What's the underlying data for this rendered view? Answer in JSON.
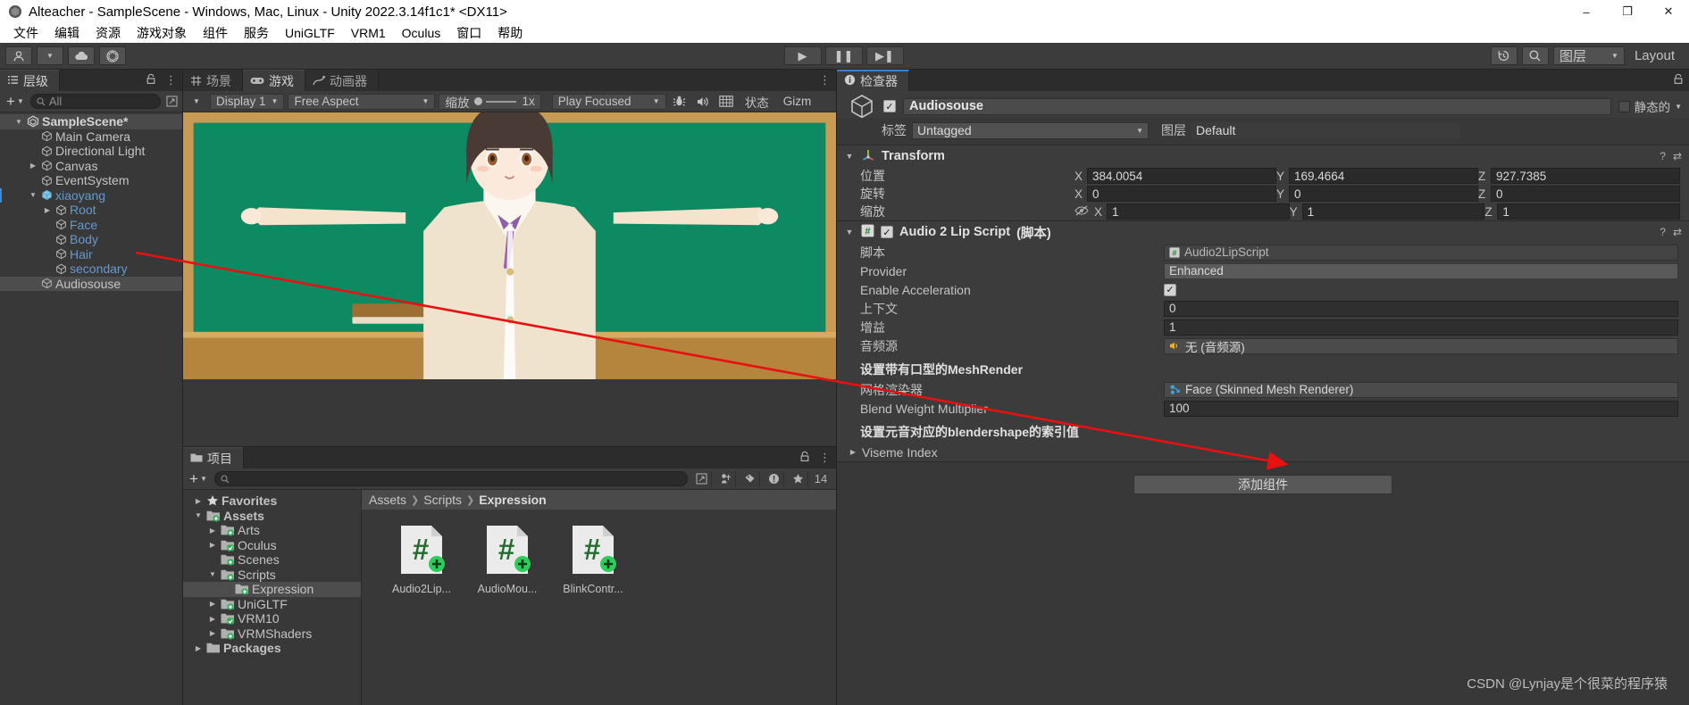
{
  "window": {
    "title": "Alteacher - SampleScene - Windows, Mac, Linux - Unity 2022.3.14f1c1* <DX11>",
    "minimize": "–",
    "maximize": "❐",
    "close": "✕"
  },
  "menu": [
    "文件",
    "编辑",
    "资源",
    "游戏对象",
    "组件",
    "服务",
    "UniGLTF",
    "VRM1",
    "Oculus",
    "窗口",
    "帮助"
  ],
  "toolbar": {
    "account_icon": "account-icon",
    "cloud_icon": "cloud-icon",
    "unity_icon": "unity-icon",
    "play": "▶",
    "pause": "❚❚",
    "step": "▶❚",
    "history_icon": "history-icon",
    "search_icon": "search-icon",
    "layers_label": "图层",
    "layout_label": "Layout"
  },
  "hierarchy": {
    "tab": "层级",
    "lock_icon": "lock-icon",
    "menu_icon": "kebab-icon",
    "add_label": "+",
    "search_placeholder": "All",
    "items": [
      {
        "label": "SampleScene*",
        "depth": 0,
        "tri": "▼",
        "icon": "unity-scene-icon",
        "bold": true,
        "selected_row": true,
        "blue": false
      },
      {
        "label": "Main Camera",
        "depth": 1,
        "tri": "",
        "icon": "cube-icon",
        "bold": false,
        "blue": false
      },
      {
        "label": "Directional Light",
        "depth": 1,
        "tri": "",
        "icon": "cube-icon",
        "bold": false,
        "blue": false
      },
      {
        "label": "Canvas",
        "depth": 1,
        "tri": "▶",
        "icon": "cube-icon",
        "bold": false,
        "blue": false
      },
      {
        "label": "EventSystem",
        "depth": 1,
        "tri": "",
        "icon": "cube-icon",
        "bold": false,
        "blue": false
      },
      {
        "label": "xiaoyang",
        "depth": 1,
        "tri": "▼",
        "icon": "prefab-icon",
        "bold": false,
        "blue": true,
        "marker": true
      },
      {
        "label": "Root",
        "depth": 2,
        "tri": "▶",
        "icon": "cube-icon",
        "bold": false,
        "blue": true
      },
      {
        "label": "Face",
        "depth": 2,
        "tri": "",
        "icon": "cube-icon",
        "bold": false,
        "blue": true
      },
      {
        "label": "Body",
        "depth": 2,
        "tri": "",
        "icon": "cube-icon",
        "bold": false,
        "blue": true
      },
      {
        "label": "Hair",
        "depth": 2,
        "tri": "",
        "icon": "cube-icon",
        "bold": false,
        "blue": true
      },
      {
        "label": "secondary",
        "depth": 2,
        "tri": "",
        "icon": "cube-icon",
        "bold": false,
        "blue": true
      },
      {
        "label": "Audiosouse",
        "depth": 1,
        "tri": "",
        "icon": "cube-icon",
        "bold": false,
        "blue": false,
        "selected": true
      }
    ]
  },
  "centerTabs": [
    {
      "label": "场景",
      "icon": "scene-icon",
      "active": false
    },
    {
      "label": "游戏",
      "icon": "game-icon",
      "active": true
    },
    {
      "label": "动画器",
      "icon": "animator-icon",
      "active": false
    }
  ],
  "gameview": {
    "display": "Display 1",
    "aspect": "Free Aspect",
    "scale_label": "缩放",
    "scale_value": "1x",
    "play_mode": "Play Focused",
    "mute_icon": "mute-audio-icon",
    "bug_icon": "bug-icon",
    "stats_label": "状态",
    "gizmos_label": "Gizm",
    "frame_icon": "frame-icon",
    "menu_icon": "kebab-icon"
  },
  "project": {
    "tab": "项目",
    "lock_icon": "lock-icon",
    "menu_icon": "kebab-icon",
    "add_label": "+",
    "search_placeholder": "",
    "hidden_count": "14",
    "icons": [
      "save-search-icon",
      "new-search-icon",
      "label-icon",
      "warning-icon",
      "favorite-icon",
      "hidden-icon"
    ],
    "tree": [
      {
        "label": "Favorites",
        "depth": 0,
        "tri": "▶",
        "icon": "star-icon",
        "bold": true
      },
      {
        "label": "Assets",
        "depth": 0,
        "tri": "▼",
        "icon": "folder-plus-icon",
        "bold": true
      },
      {
        "label": "Arts",
        "depth": 1,
        "tri": "▶",
        "icon": "folder-plus-icon",
        "bold": false
      },
      {
        "label": "Oculus",
        "depth": 1,
        "tri": "▶",
        "icon": "folder-check-icon",
        "bold": false
      },
      {
        "label": "Scenes",
        "depth": 1,
        "tri": "",
        "icon": "folder-plus-icon",
        "bold": false
      },
      {
        "label": "Scripts",
        "depth": 1,
        "tri": "▼",
        "icon": "folder-plus-icon",
        "bold": false
      },
      {
        "label": "Expression",
        "depth": 2,
        "tri": "",
        "icon": "folder-plus-icon",
        "bold": false,
        "selected": true
      },
      {
        "label": "UniGLTF",
        "depth": 1,
        "tri": "▶",
        "icon": "folder-plus-icon",
        "bold": false
      },
      {
        "label": "VRM10",
        "depth": 1,
        "tri": "▶",
        "icon": "folder-check-icon",
        "bold": false
      },
      {
        "label": "VRMShaders",
        "depth": 1,
        "tri": "▶",
        "icon": "folder-plus-icon",
        "bold": false
      },
      {
        "label": "Packages",
        "depth": 0,
        "tri": "▶",
        "icon": "folder-icon",
        "bold": true
      }
    ],
    "breadcrumb": [
      "Assets",
      "Scripts",
      "Expression"
    ],
    "assets": [
      {
        "name": "Audio2Lip...",
        "type": "csharp-script"
      },
      {
        "name": "AudioMou...",
        "type": "csharp-script"
      },
      {
        "name": "BlinkContr...",
        "type": "csharp-script"
      }
    ]
  },
  "inspector": {
    "tab": "检查器",
    "info_icon": "info-icon",
    "lock_icon": "lock-icon",
    "object": {
      "name": "Audiosouse",
      "enabled": true,
      "static_label": "静态的",
      "tag_label": "标签",
      "tag_value": "Untagged",
      "layer_label": "图层",
      "layer_value": "Default"
    },
    "transform": {
      "title": "Transform",
      "help_icon": "help-icon",
      "menu_icon": "kebab-icon",
      "rows": [
        {
          "label": "位置",
          "x": "384.0054",
          "y": "169.4664",
          "z": "927.7385",
          "lock": false
        },
        {
          "label": "旋转",
          "x": "0",
          "y": "0",
          "z": "0",
          "lock": false
        },
        {
          "label": "缩放",
          "x": "1",
          "y": "1",
          "z": "1",
          "lock": true
        }
      ],
      "axes": [
        "X",
        "Y",
        "Z"
      ]
    },
    "script_component": {
      "title": "Audio 2 Lip Script",
      "suffix": "(脚本)",
      "enabled": true,
      "help_icon": "help-icon",
      "menu_icon": "kebab-icon",
      "rows": [
        {
          "label": "脚本",
          "value": "Audio2LipScript",
          "kind": "object",
          "dim": true,
          "icon": "csharp-icon"
        },
        {
          "label": "Provider",
          "value": "Enhanced",
          "kind": "dropdown"
        },
        {
          "label": "Enable Acceleration",
          "value": "✓",
          "kind": "checkbox"
        },
        {
          "label": "上下文",
          "value": "0",
          "kind": "field"
        },
        {
          "label": "增益",
          "value": "1",
          "kind": "field"
        },
        {
          "label": "音频源",
          "value": "无 (音频源)",
          "kind": "object",
          "icon": "audio-icon"
        }
      ],
      "note1": "设置带有口型的MeshRender",
      "rows2": [
        {
          "label": "网格渲染器",
          "value": "Face (Skinned Mesh Renderer)",
          "kind": "object",
          "icon": "skinned-mesh-icon"
        },
        {
          "label": "Blend Weight Multiplier",
          "value": "100",
          "kind": "field"
        }
      ],
      "note2": "设置元音对应的blendershape的索引值",
      "foldout": {
        "tri": "▶",
        "label": "Viseme Index"
      }
    },
    "add_component": "添加组件"
  },
  "watermark": "CSDN @Lynjay是个很菜的程序猿",
  "colors": {
    "accent_blue": "#3d8ad7",
    "panel_bg": "#3c3c3c",
    "dark_bg": "#2a2a2a",
    "text": "#c4c4c4",
    "arrow_red": "#e81010",
    "board_green": "#0d8a62"
  }
}
